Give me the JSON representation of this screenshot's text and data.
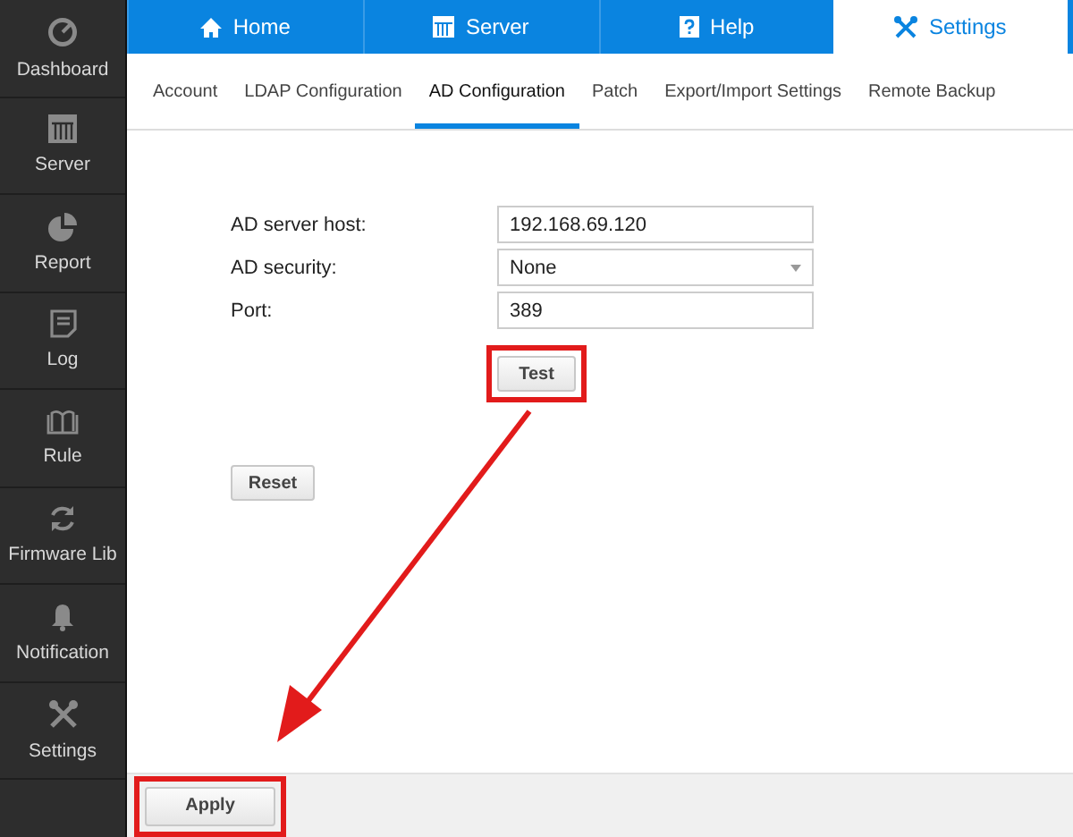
{
  "sidebar": {
    "items": [
      {
        "label": "Dashboard"
      },
      {
        "label": "Server"
      },
      {
        "label": "Report"
      },
      {
        "label": "Log"
      },
      {
        "label": "Rule"
      },
      {
        "label": "Firmware Lib"
      },
      {
        "label": "Notification"
      },
      {
        "label": "Settings"
      }
    ]
  },
  "top_nav": {
    "tabs": [
      {
        "label": "Home",
        "selected": false
      },
      {
        "label": "Server",
        "selected": false
      },
      {
        "label": "Help",
        "selected": false
      },
      {
        "label": "Settings",
        "selected": true
      }
    ]
  },
  "sub_tabs": [
    {
      "label": "Account",
      "selected": false
    },
    {
      "label": "LDAP Configuration",
      "selected": false
    },
    {
      "label": "AD Configuration",
      "selected": true
    },
    {
      "label": "Patch",
      "selected": false
    },
    {
      "label": "Export/Import Settings",
      "selected": false
    },
    {
      "label": "Remote Backup",
      "selected": false
    }
  ],
  "form": {
    "fields": [
      {
        "label": "AD server host:",
        "kind": "text",
        "value": "192.168.69.120"
      },
      {
        "label": "AD security:",
        "kind": "select",
        "value": "None"
      },
      {
        "label": "Port:",
        "kind": "text",
        "value": "389"
      }
    ],
    "test_button": {
      "label": "Test",
      "highlighted": true
    },
    "reset_button": {
      "label": "Reset",
      "highlighted": false
    }
  },
  "footer": {
    "apply_button": {
      "label": "Apply",
      "highlighted": true
    }
  },
  "annotations": [
    {
      "kind": "arrow"
    }
  ]
}
